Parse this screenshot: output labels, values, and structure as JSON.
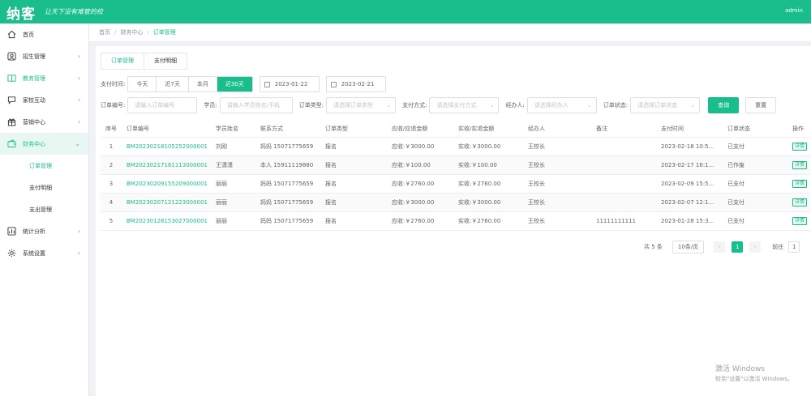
{
  "header": {
    "logo": "纳客",
    "slogan": "让天下没有难管的校",
    "user": "admin"
  },
  "sidebar": {
    "items": [
      {
        "label": "首页",
        "icon": "home-icon",
        "arrow": ""
      },
      {
        "label": "招生管理",
        "icon": "user-icon",
        "arrow": "›"
      },
      {
        "label": "教务管理",
        "icon": "book-icon",
        "arrow": "›"
      },
      {
        "label": "家校互动",
        "icon": "chat-icon",
        "arrow": "›"
      },
      {
        "label": "营销中心",
        "icon": "gift-icon",
        "arrow": "›"
      },
      {
        "label": "财务中心",
        "icon": "wallet-icon",
        "arrow": "⌄"
      }
    ],
    "sub_items": [
      "订单管理",
      "支付明细",
      "支出管理"
    ],
    "items_bottom": [
      {
        "label": "统计分析",
        "icon": "chart-icon",
        "arrow": "›"
      },
      {
        "label": "系统设置",
        "icon": "settings-icon",
        "arrow": "›"
      }
    ]
  },
  "breadcrumb": {
    "home": "首页",
    "parent": "财务中心",
    "current": "订单管理",
    "sep": "/"
  },
  "tabs": [
    "订单管理",
    "支付明细"
  ],
  "filters": {
    "pay_time_label": "支付时间:",
    "ranges": [
      "今天",
      "近7天",
      "本月",
      "近30天"
    ],
    "active_range": "近30天",
    "start_date": "2023-01-22",
    "end_date": "2023-02-21",
    "order_no_label": "订单编号:",
    "order_no_placeholder": "请输入订单编号",
    "student_label": "学员:",
    "student_placeholder": "请输入学员姓名/手机",
    "order_type_label": "订单类型:",
    "order_type_placeholder": "请选择订单类型",
    "pay_method_label": "支付方式:",
    "pay_method_placeholder": "请选择支付方式",
    "handler_label": "经办人:",
    "handler_placeholder": "请选择经办人",
    "status_label": "订单状态:",
    "status_placeholder": "请选择订单状态",
    "query_button": "查询",
    "reset_button": "重置"
  },
  "table": {
    "columns": [
      "序号",
      "订单编号",
      "学员姓名",
      "联系方式",
      "订单类型",
      "应收/应退金额",
      "实收/实退金额",
      "经办人",
      "备注",
      "支付时间",
      "订单状态",
      "操作"
    ],
    "rows": [
      {
        "idx": "1",
        "order": "BM20230218105252000001",
        "student": "刘刚",
        "contact": "妈妈 15071775659",
        "type": "报名",
        "due": "应收:￥3000.00",
        "paid": "实收:￥3000.00",
        "handler": "王校长",
        "note": "",
        "time": "2023-02-18 10:5...",
        "status": "已支付",
        "action": "详情"
      },
      {
        "idx": "2",
        "order": "BM20230217161113000001",
        "student": "王潇潇",
        "contact": "本人 15911119880",
        "type": "报名",
        "due": "应收:￥100.00",
        "paid": "实收:￥100.00",
        "handler": "王校长",
        "note": "",
        "time": "2023-02-17 16:1...",
        "status": "已作废",
        "action": "详情"
      },
      {
        "idx": "3",
        "order": "BM20230209155209000001",
        "student": "丽丽",
        "contact": "妈妈 15071775659",
        "type": "报名",
        "due": "应收:￥2760.00",
        "paid": "实收:￥2760.00",
        "handler": "王校长",
        "note": "",
        "time": "2023-02-09 15:5...",
        "status": "已支付",
        "action": "详情"
      },
      {
        "idx": "4",
        "order": "BM20230207121223000001",
        "student": "丽丽",
        "contact": "妈妈 15071775659",
        "type": "报名",
        "due": "应收:￥3000.00",
        "paid": "实收:￥3000.00",
        "handler": "王校长",
        "note": "",
        "time": "2023-02-07 12:1...",
        "status": "已支付",
        "action": "详情"
      },
      {
        "idx": "5",
        "order": "BM20230128153027000001",
        "student": "丽丽",
        "contact": "妈妈 15071775659",
        "type": "报名",
        "due": "应收:￥2760.00",
        "paid": "实收:￥2760.00",
        "handler": "王校长",
        "note": "11111111111",
        "time": "2023-01-28 15:3...",
        "status": "已支付",
        "action": "详情"
      }
    ]
  },
  "pagination": {
    "total": "共 5 条",
    "page_size": "10条/页",
    "prev": "‹",
    "page": "1",
    "next": "›",
    "goto": "前往",
    "goto_value": "1"
  },
  "watermark": {
    "line1": "激活 Windows",
    "line2": "转到\"设置\"以激活 Windows。"
  },
  "colors": {
    "brand": "#19be8c"
  }
}
